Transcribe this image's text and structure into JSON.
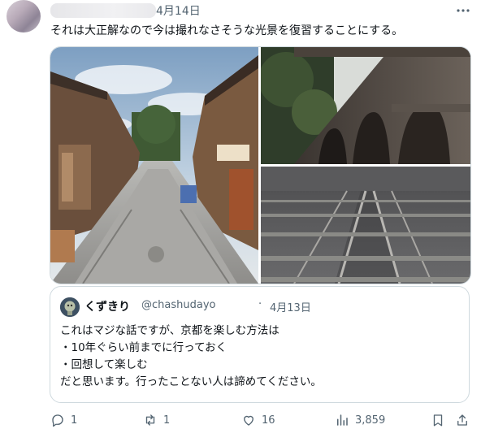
{
  "post": {
    "date": "4月14日",
    "text": "それは大正解なので今は撮れなさそうな光景を復習することにする。"
  },
  "quote": {
    "display_name": "くずきり",
    "handle": "@chashudayo",
    "separator": "·",
    "date": "4月13日",
    "lines": [
      "これはマジな話ですが、京都を楽しむ方法は",
      "・10年ぐらい前までに行っておく",
      "・回想して楽しむ",
      "だと思います。行ったことない人は諦めてください。"
    ]
  },
  "actions": {
    "replies": "1",
    "reposts": "1",
    "likes": "16",
    "views": "3,859"
  },
  "colors": {
    "text": "#0f1419",
    "muted": "#536471",
    "border": "#cfd9de"
  },
  "icons": [
    "more-icon",
    "reply-icon",
    "repost-icon",
    "like-icon",
    "views-icon",
    "bookmark-icon",
    "share-icon"
  ]
}
